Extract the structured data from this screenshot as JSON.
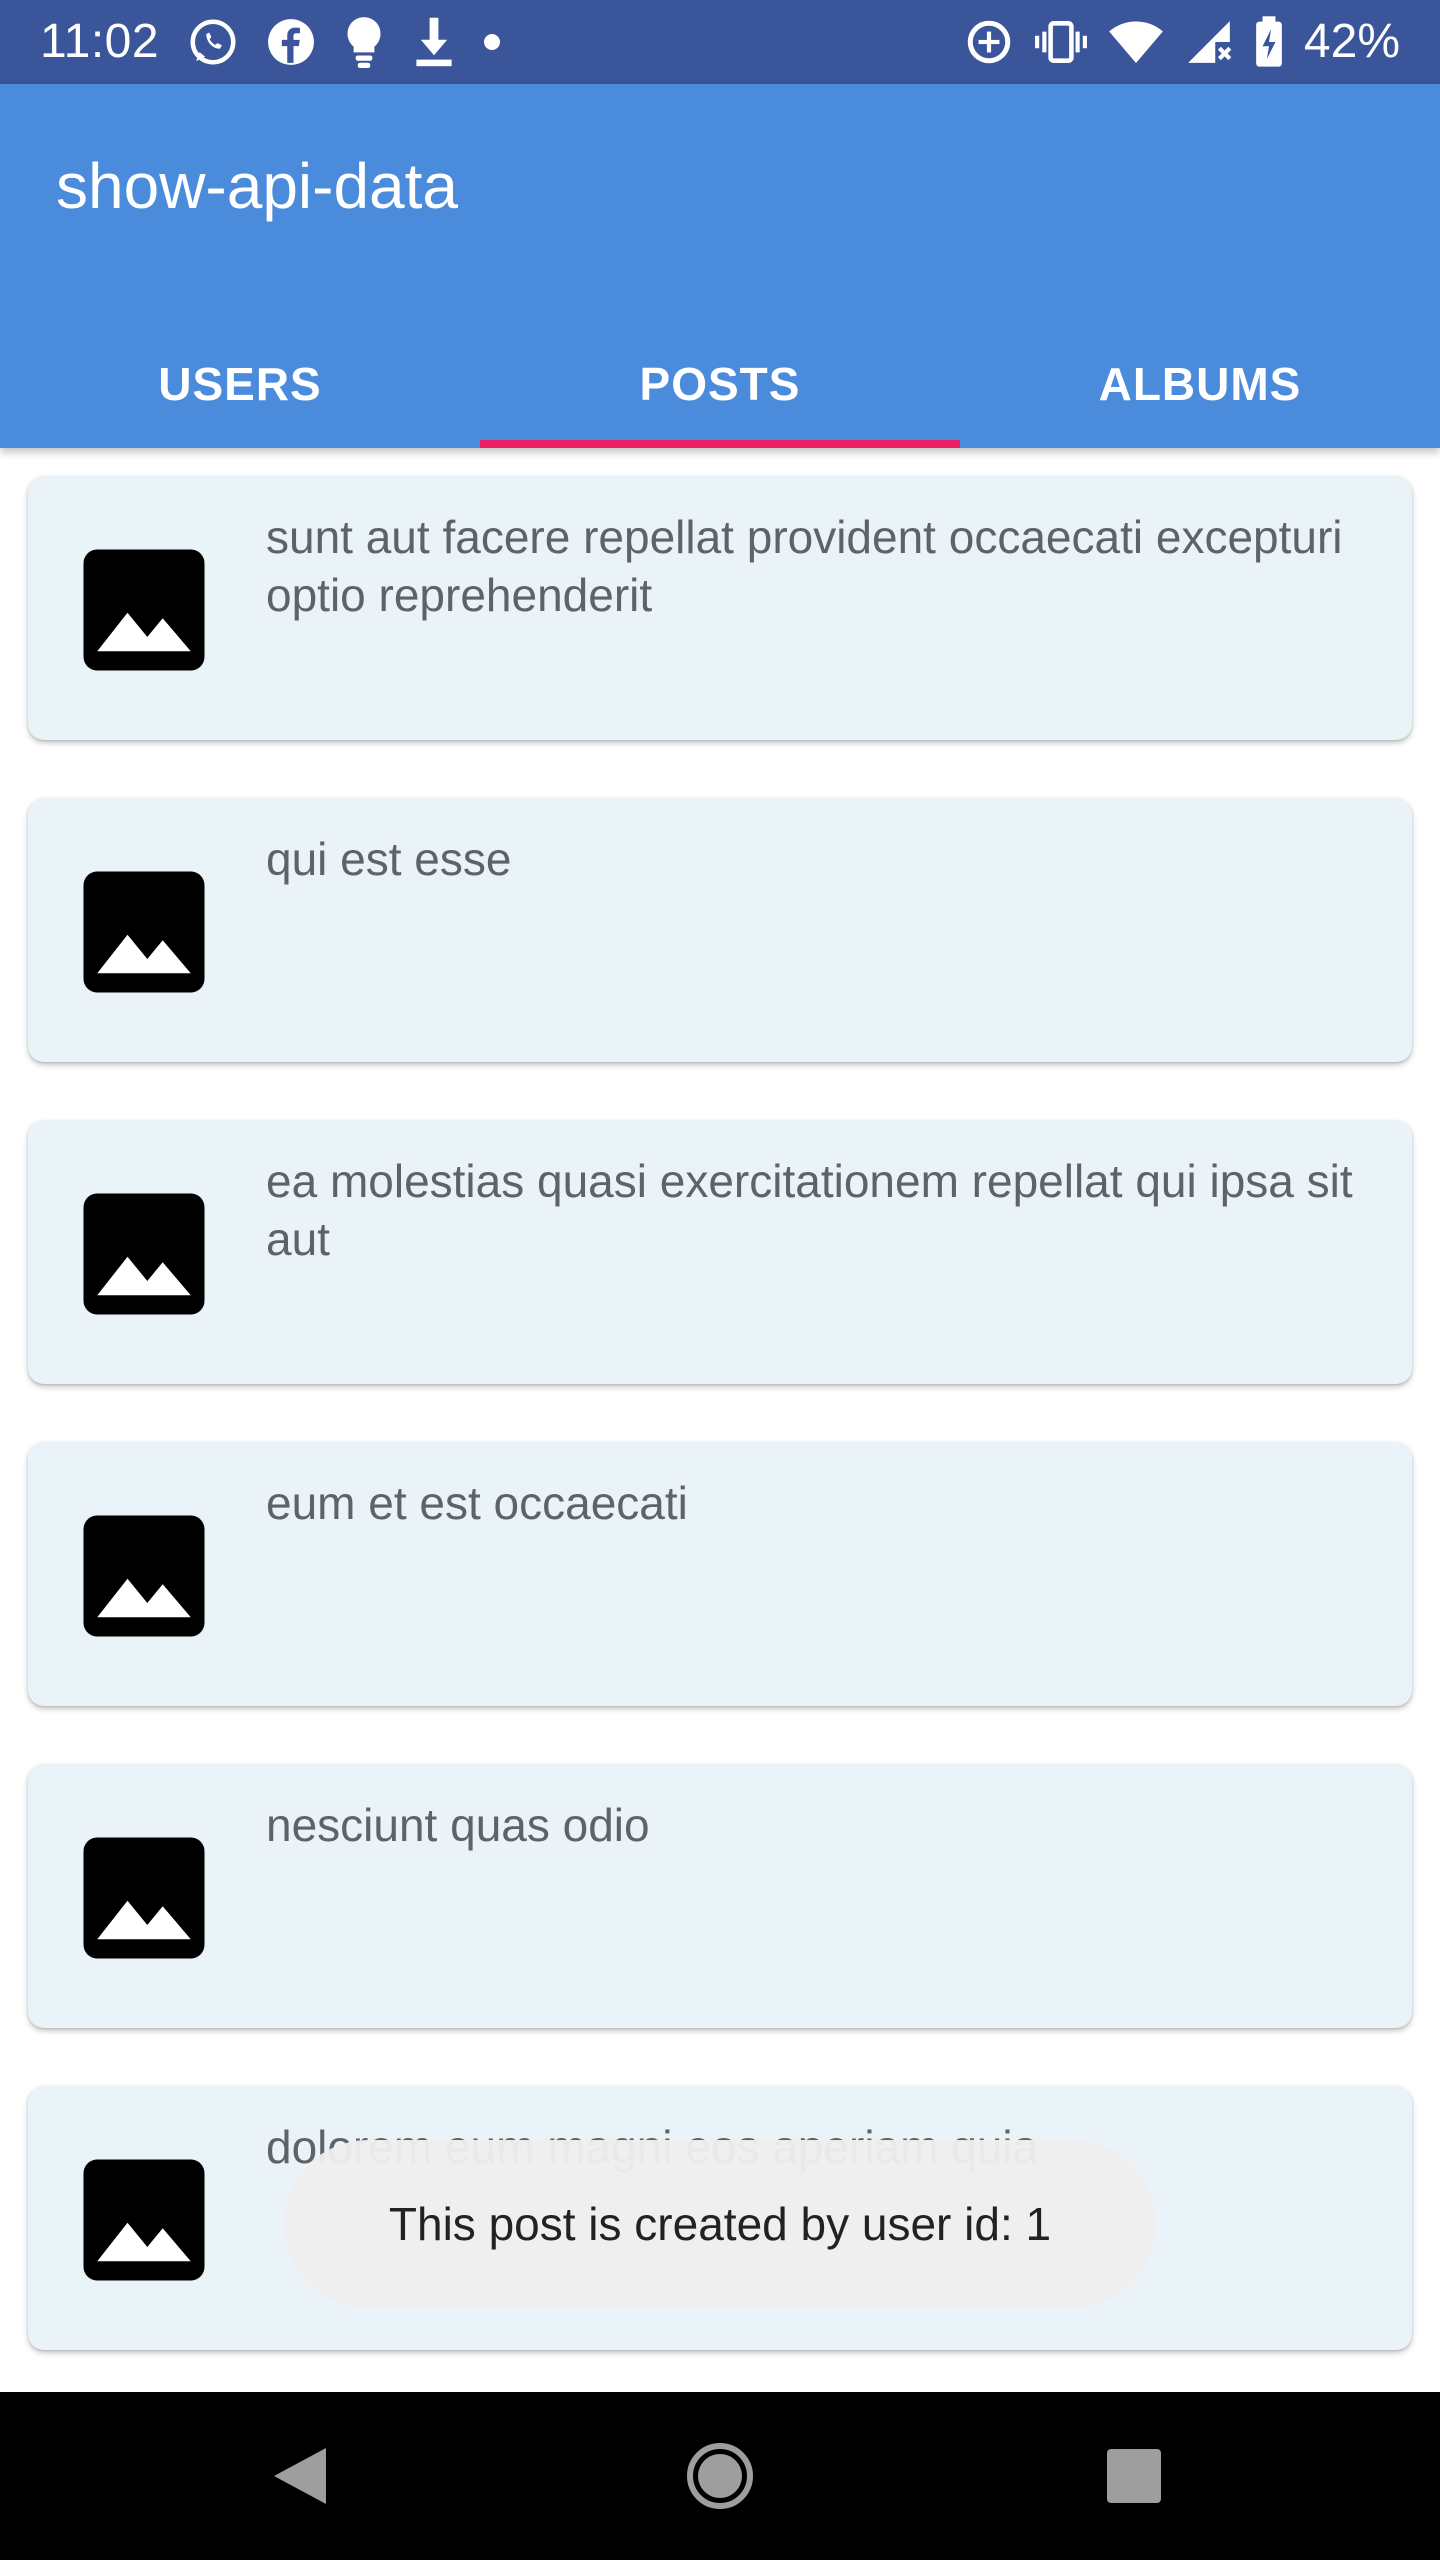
{
  "status_bar": {
    "time": "11:02",
    "battery_percent": "42%",
    "left_icons": [
      "whatsapp-icon",
      "facebook-icon",
      "lightbulb-icon",
      "download-icon",
      "dot-icon"
    ],
    "right_icons": [
      "data-saver-icon",
      "vibrate-icon",
      "wifi-icon",
      "signal-icon",
      "battery-charging-icon"
    ]
  },
  "app_bar": {
    "title": "show-api-data",
    "background": "#4a8bdb"
  },
  "tabs": [
    {
      "label": "USERS",
      "selected": false
    },
    {
      "label": "POSTS",
      "selected": true
    },
    {
      "label": "ALBUMS",
      "selected": false
    }
  ],
  "tab_indicator_color": "#e91e63",
  "posts": [
    {
      "title": "sunt aut facere repellat provident occaecati excepturi optio reprehenderit",
      "icon": "image-icon"
    },
    {
      "title": "qui est esse",
      "icon": "image-icon"
    },
    {
      "title": "ea molestias quasi exercitationem repellat qui ipsa sit aut",
      "icon": "image-icon"
    },
    {
      "title": "eum et est occaecati",
      "icon": "image-icon"
    },
    {
      "title": "nesciunt quas odio",
      "icon": "image-icon"
    },
    {
      "title": "dolorem eum magni eos aperiam quia",
      "icon": "image-icon"
    }
  ],
  "toast": {
    "message": "This post is created by user id: 1"
  },
  "nav_bar": {
    "buttons": [
      "back-icon",
      "home-icon",
      "recents-icon"
    ]
  }
}
